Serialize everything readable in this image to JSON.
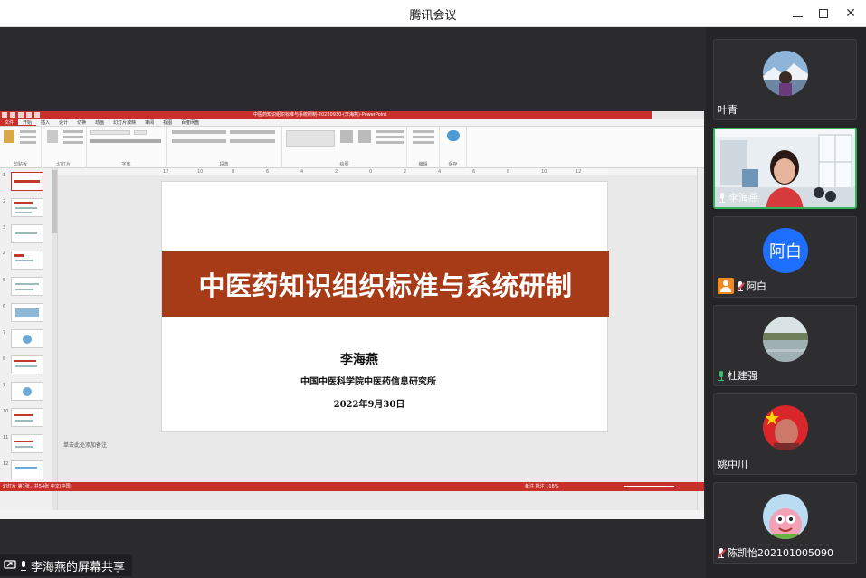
{
  "window": {
    "title": "腾讯会议",
    "minimize_label": "",
    "maximize_label": "",
    "close_label": "✕"
  },
  "ppt": {
    "doc_title": "中医药知识组织标准与系统研制-20220930-(李海燕)-PowerPoint",
    "tabs": [
      "文件",
      "开始",
      "插入",
      "设计",
      "切换",
      "动画",
      "幻灯片放映",
      "审阅",
      "视图",
      "百度网盘"
    ],
    "groups": [
      "剪贴板",
      "幻灯片",
      "字体",
      "段落",
      "绘图",
      "编辑",
      "保存"
    ],
    "ruler_ticks": [
      "12",
      "10",
      "8",
      "6",
      "4",
      "2",
      "0",
      "2",
      "4",
      "6",
      "8",
      "10",
      "12"
    ],
    "thumb_numbers": [
      "1",
      "2",
      "3",
      "4",
      "5",
      "6",
      "7",
      "8",
      "9",
      "10",
      "11",
      "12"
    ],
    "notes_placeholder": "单击此处添加备注",
    "status_left": "幻灯片 第1张，共54张   中文(中国)",
    "status_right": "备注   批注              118%"
  },
  "slide": {
    "title": "中医药知识组织标准与系统研制",
    "author": "李海燕",
    "institution": "中国中医科学院中医药信息研究所",
    "date": "2022年9月30日"
  },
  "share_label": "李海燕的屏幕共享",
  "participants": [
    {
      "name": "叶青",
      "mic": "none",
      "avatar": "photo-landscape"
    },
    {
      "name": "李海燕",
      "mic": "white",
      "avatar": "video"
    },
    {
      "name": "阿白",
      "mic": "muted",
      "avatar": "text",
      "avatar_text": "阿白",
      "avatar_color": "#1e6fff"
    },
    {
      "name": "杜建强",
      "mic": "green",
      "avatar": "photo-river"
    },
    {
      "name": "姚中川",
      "mic": "none",
      "avatar": "photo-flag"
    },
    {
      "name": "陈凯怡202101005090",
      "mic": "muted",
      "avatar": "photo-cartoon"
    }
  ]
}
